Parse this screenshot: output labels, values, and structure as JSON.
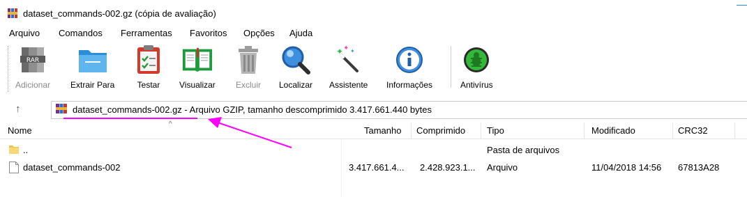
{
  "window": {
    "title": "dataset_commands-002.gz (cópia de avaliação)",
    "accent_color": "#2f8bd1"
  },
  "menu": {
    "items": [
      "Arquivo",
      "Comandos",
      "Ferramentas",
      "Favoritos",
      "Opções",
      "Ajuda"
    ]
  },
  "toolbar": {
    "buttons": [
      {
        "label": "Adicionar",
        "icon": "archive-add-icon",
        "enabled": false
      },
      {
        "label": "Extrair Para",
        "icon": "folder-extract-icon",
        "enabled": true
      },
      {
        "label": "Testar",
        "icon": "clipboard-test-icon",
        "enabled": true
      },
      {
        "label": "Visualizar",
        "icon": "book-view-icon",
        "enabled": true
      },
      {
        "label": "Excluir",
        "icon": "trash-icon",
        "enabled": false
      },
      {
        "label": "Localizar",
        "icon": "magnifier-icon",
        "enabled": true
      },
      {
        "label": "Assistente",
        "icon": "magic-wand-icon",
        "enabled": true
      },
      {
        "label": "Informações",
        "icon": "info-icon",
        "enabled": true
      },
      {
        "label": "Antivírus",
        "icon": "antivirus-bug-icon",
        "enabled": true
      }
    ]
  },
  "address": {
    "text": "dataset_commands-002.gz - Arquivo GZIP, tamanho descomprimido 3.417.661.440 bytes",
    "up_icon": "up-arrow-icon"
  },
  "columns": [
    "Nome",
    "Tamanho",
    "Comprimido",
    "Tipo",
    "Modificado",
    "CRC32"
  ],
  "rows": [
    {
      "name": "..",
      "size": "",
      "packed": "",
      "type": "Pasta de arquivos",
      "modified": "",
      "crc": "",
      "icon": "folder-icon"
    },
    {
      "name": "dataset_commands-002",
      "size": "3.417.661.4...",
      "packed": "2.428.923.1...",
      "type": "Arquivo",
      "modified": "11/04/2018 14:56",
      "crc": "67813A28",
      "icon": "file-icon"
    }
  ],
  "annotation": {
    "color": "#ff00ff"
  }
}
